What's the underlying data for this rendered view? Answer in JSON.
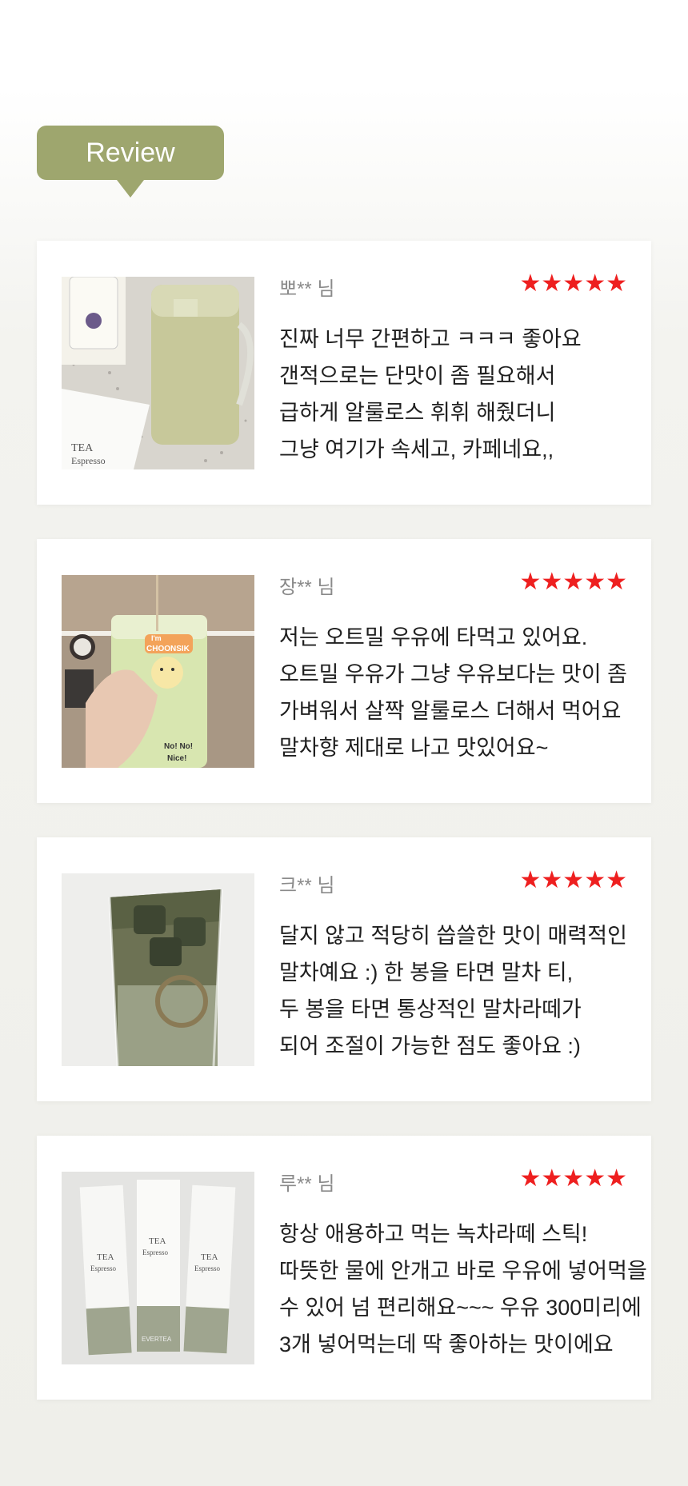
{
  "badge": {
    "label": "Review"
  },
  "reviews": [
    {
      "reviewer": "뽀** 님",
      "stars": "★★★★★",
      "rating": 5,
      "lines": [
        "진짜 너무 간편하고 ㅋㅋㅋ 좋아요",
        "갠적으로는 단맛이 좀 필요해서",
        "급하게 알룰로스 휘휘 해줬더니",
        "그냥 여기가 속세고, 카페네요,,"
      ],
      "photo_icon": "matcha-latte-mug-photo",
      "photo_text": {
        "brand": "TEA",
        "sub": "Espresso"
      }
    },
    {
      "reviewer": "장** 님",
      "stars": "★★★★★",
      "rating": 5,
      "lines": [
        "저는 오트밀 우유에 타먹고 있어요.",
        "오트밀 우유가 그냥 우유보다는 맛이 좀",
        "가벼워서 살짝 알룰로스 더해서 먹어요",
        "말차향 제대로 나고 맛있어요~"
      ],
      "photo_icon": "matcha-glass-can-photo",
      "photo_text": {
        "line1": "I'm",
        "line2": "CHOONSIK",
        "line3": "No! No!",
        "line4": "Nice!"
      }
    },
    {
      "reviewer": "크** 님",
      "stars": "★★★★★",
      "rating": 5,
      "lines": [
        "달지 않고 적당히 씁쓸한 맛이 매력적인",
        "말차예요 :) 한 봉을 타면 말차 티,",
        "두 봉을 타면 통상적인 말차라떼가",
        "되어 조절이 가능한 점도 좋아요 :)"
      ],
      "photo_icon": "iced-matcha-latte-photo"
    },
    {
      "reviewer": "루** 님",
      "stars": "★★★★★",
      "rating": 5,
      "lines": [
        "항상 애용하고 먹는 녹차라떼 스틱!",
        "따뜻한 물에 안개고 바로 우유에 넣어먹을",
        "수 있어 넘 편리해요~~~ 우유 300미리에",
        "3개 넣어먹는데 딱 좋아하는 맛이에요"
      ],
      "photo_icon": "tea-stick-packets-photo",
      "photo_text": {
        "brand": "TEA",
        "sub": "Espresso",
        "maker": "EVERTEA"
      }
    }
  ],
  "colors": {
    "badge": "#9ea66e",
    "stars": "#ee1f1f",
    "text": "#1f1f1f",
    "reviewer": "#8a8a8a"
  }
}
